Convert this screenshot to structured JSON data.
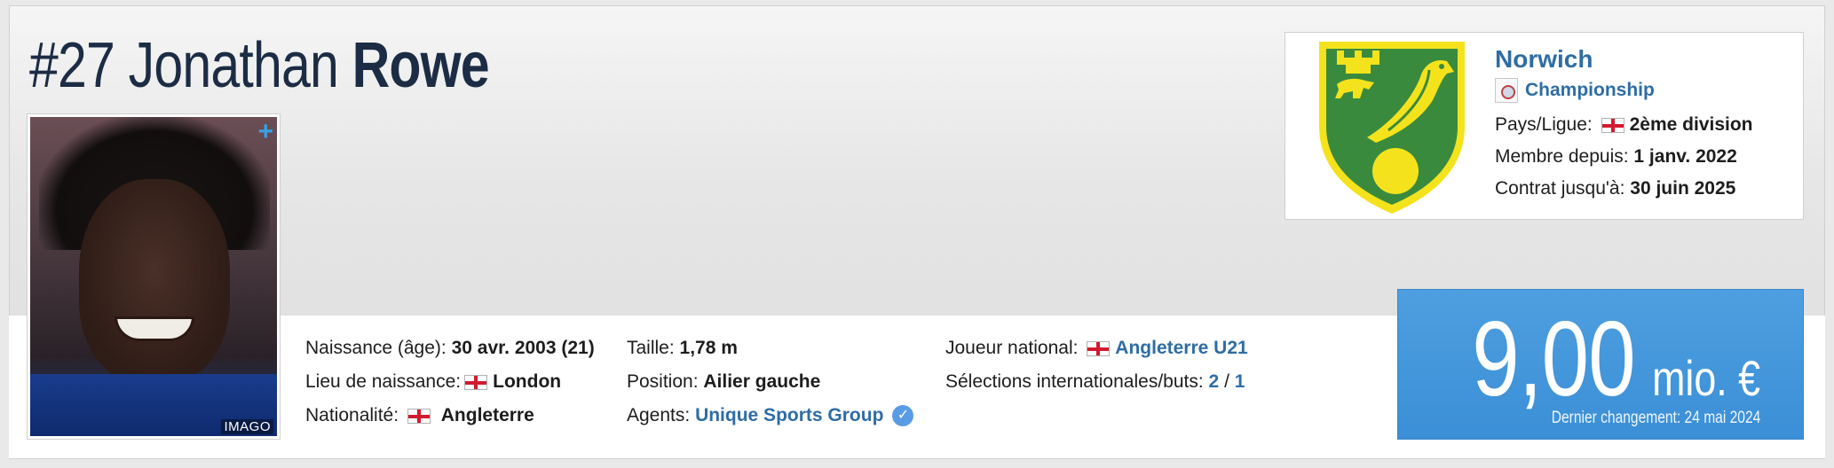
{
  "player": {
    "shirt_number": "#27",
    "first_name": "Jonathan",
    "last_name": "Rowe",
    "photo": {
      "plus_symbol": "+",
      "credit": "IMAGO"
    }
  },
  "details": {
    "birth_label": "Naissance (âge):",
    "birth_value": "30 avr. 2003 (21)",
    "birthplace_label": "Lieu de naissance:",
    "birthplace_value": "London",
    "nationality_label": "Nationalité:",
    "nationality_value": "Angleterre",
    "height_label": "Taille:",
    "height_value": "1,78 m",
    "position_label": "Position:",
    "position_value": "Ailier gauche",
    "agent_label": "Agents:",
    "agent_value": "Unique Sports Group",
    "national_label": "Joueur national:",
    "national_value": "Angleterre U21",
    "caps_label": "Sélections internationales/buts:",
    "caps_value": "2",
    "caps_sep": "/",
    "goals_value": "1"
  },
  "club": {
    "name": "Norwich",
    "league": "Championship",
    "country_label": "Pays/Ligue:",
    "country_value": "2ème division",
    "joined_label": "Membre depuis:",
    "joined_value": "1 janv. 2022",
    "contract_label": "Contrat jusqu'à:",
    "contract_value": "30 juin 2025"
  },
  "market_value": {
    "amount": "9,00",
    "unit": "mio. €",
    "last_change": "Dernier changement: 24 mai 2024"
  },
  "colors": {
    "link": "#2e6da4",
    "value_box": "#4296db",
    "title": "#1c2c44",
    "crest_green": "#3a8a3e",
    "crest_yellow": "#f4e31c"
  },
  "icons": [
    "england-flag-icon",
    "verified-icon",
    "championship-league-icon",
    "norwich-crest-icon"
  ]
}
